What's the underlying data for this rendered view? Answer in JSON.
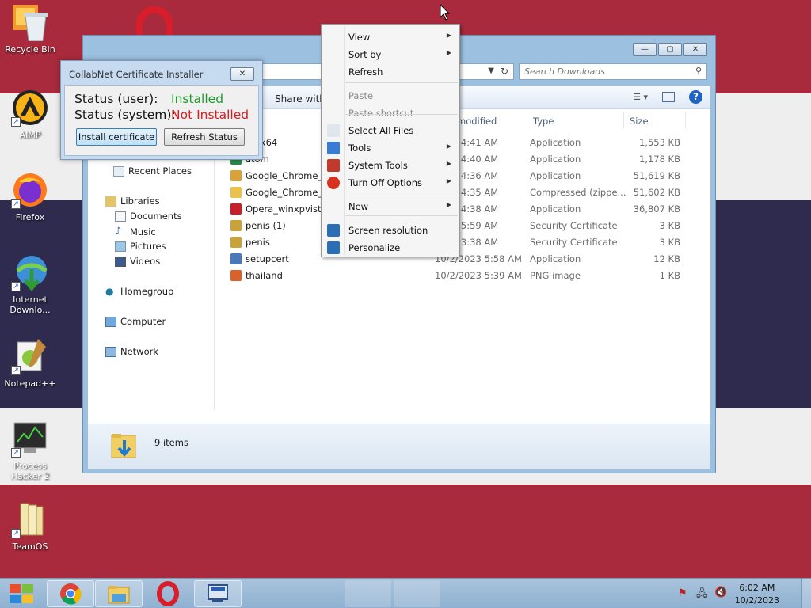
{
  "desktop": {
    "icons": [
      {
        "label": "Recycle Bin"
      },
      {
        "label": "AIMP"
      },
      {
        "label": "Firefox"
      },
      {
        "label": "Internet Downlo..."
      },
      {
        "label": "Notepad++"
      },
      {
        "label": "Process Hacker 2"
      },
      {
        "label": "TeamOS"
      }
    ]
  },
  "explorer": {
    "search_placeholder": "Search Downloads",
    "toolbar": {
      "share_with": "Share with"
    },
    "columns": {
      "modified": "modified",
      "type": "Type",
      "size": "Size"
    },
    "nav": {
      "recent_places": "Recent Places",
      "libraries": "Libraries",
      "documents": "Documents",
      "music": "Music",
      "pictures": "Pictures",
      "videos": "Videos",
      "homegroup": "Homegroup",
      "computer": "Computer",
      "network": "Network"
    },
    "files": [
      {
        "name": "01-x64",
        "date": "2023 4:41 AM",
        "type": "Application",
        "size": "1,553 KB",
        "icon_color": "#3a6fc4"
      },
      {
        "name": "atom",
        "date": "2023 4:40 AM",
        "type": "Application",
        "size": "1,178 KB",
        "icon_color": "#2a8a4a"
      },
      {
        "name": "Google_Chrome_70",
        "date": "2023 4:36 AM",
        "type": "Application",
        "size": "51,619 KB",
        "icon_color": "#d9a33a"
      },
      {
        "name": "Google_Chrome_70",
        "date": "2023 4:35 AM",
        "type": "Compressed (zippe...",
        "size": "51,602 KB",
        "icon_color": "#e8c24a"
      },
      {
        "name": "Opera_winxpvista_",
        "date": "2023 4:38 AM",
        "type": "Application",
        "size": "36,807 KB",
        "icon_color": "#c8202a"
      },
      {
        "name": "penis (1)",
        "date": "2023 5:59 AM",
        "type": "Security Certificate",
        "size": "3 KB",
        "icon_color": "#c9a23a"
      },
      {
        "name": "penis",
        "date": "2023 3:38 AM",
        "type": "Security Certificate",
        "size": "3 KB",
        "icon_color": "#c9a23a"
      },
      {
        "name": "setupcert",
        "date": "10/2/2023 5:58 AM",
        "type": "Application",
        "size": "12 KB",
        "icon_color": "#4a78b8"
      },
      {
        "name": "thailand",
        "date": "10/2/2023 5:39 AM",
        "type": "PNG image",
        "size": "1 KB",
        "icon_color": "#d9622a"
      }
    ],
    "status": {
      "item_count": "9 items"
    }
  },
  "cert_dialog": {
    "title": "CollabNet Certificate Installer",
    "user_label": "Status (user):",
    "user_value": "Installed",
    "user_color": "#1f9a2a",
    "system_label": "Status (system):",
    "system_value": "Not Installed",
    "system_color": "#d81e1e",
    "install_button": "Install certificate",
    "refresh_button": "Refresh Status"
  },
  "context_menu": {
    "items": [
      {
        "label": "View",
        "submenu": true,
        "disabled": false
      },
      {
        "label": "Sort by",
        "submenu": true,
        "disabled": false
      },
      {
        "label": "Refresh",
        "submenu": false,
        "disabled": false
      },
      {
        "label": "Paste",
        "submenu": false,
        "disabled": true
      },
      {
        "label": "Paste shortcut",
        "submenu": false,
        "disabled": true
      },
      {
        "label": "Select All Files",
        "submenu": false,
        "disabled": false
      },
      {
        "label": "Tools",
        "submenu": true,
        "disabled": false
      },
      {
        "label": "System Tools",
        "submenu": true,
        "disabled": false
      },
      {
        "label": "Turn Off Options",
        "submenu": true,
        "disabled": false
      },
      {
        "label": "New",
        "submenu": true,
        "disabled": false
      },
      {
        "label": "Screen resolution",
        "submenu": false,
        "disabled": false
      },
      {
        "label": "Personalize",
        "submenu": false,
        "disabled": false
      }
    ]
  },
  "taskbar": {
    "clock_time": "6:02 AM",
    "clock_date": "10/2/2023"
  }
}
